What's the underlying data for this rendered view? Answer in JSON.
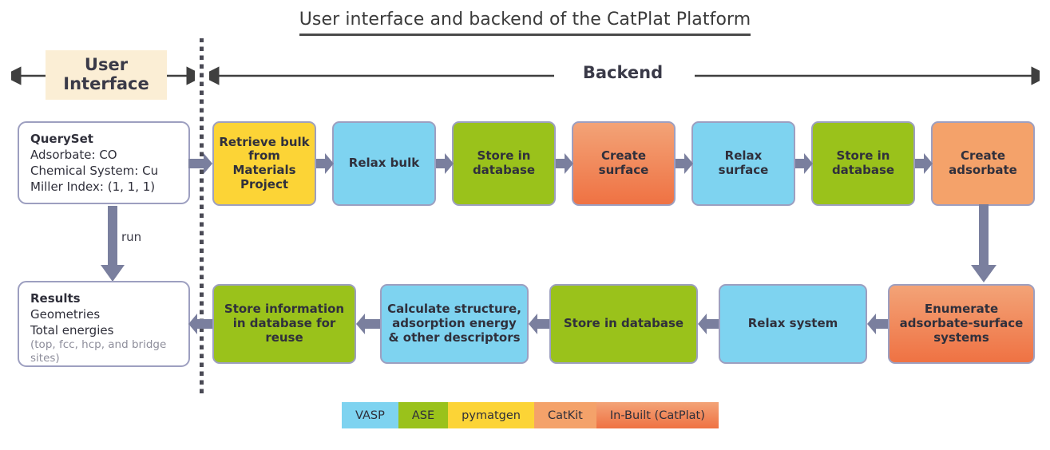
{
  "title": "User interface and backend of the CatPlat Platform",
  "headers": {
    "user_interface": "User\nInterface",
    "user_interface_line1": "User",
    "user_interface_line2": "Interface",
    "backend": "Backend"
  },
  "user_interface": {
    "queryset": {
      "title": "QuerySet",
      "line1": "Adsorbate: CO",
      "line2": "Chemical System: Cu",
      "line3": "Miller Index: (1, 1, 1)"
    },
    "run_label": "run",
    "results": {
      "title": "Results",
      "line1": "Geometries",
      "line2": "Total energies",
      "note": "(top, fcc, hcp, and bridge sites)"
    }
  },
  "backend": {
    "row1": [
      {
        "label": "Retrieve bulk from Materials Project",
        "tool": "pymatgen",
        "color": "#fcd436"
      },
      {
        "label": "Relax bulk",
        "tool": "VASP",
        "color": "#7ed3f0"
      },
      {
        "label": "Store in database",
        "tool": "ASE",
        "color": "#9ac21b"
      },
      {
        "label": "Create surface",
        "tool": "In-Built (CatPlat)",
        "color": "#ef7243"
      },
      {
        "label": "Relax surface",
        "tool": "VASP",
        "color": "#7ed3f0"
      },
      {
        "label": "Store in database",
        "tool": "ASE",
        "color": "#9ac21b"
      },
      {
        "label": "Create adsorbate",
        "tool": "CatKit",
        "color": "#f4a26a"
      }
    ],
    "row2": [
      {
        "label": "Store information in database for reuse",
        "tool": "ASE",
        "color": "#9ac21b"
      },
      {
        "label": "Calculate structure, adsorption energy & other descriptors",
        "tool": "VASP",
        "color": "#7ed3f0"
      },
      {
        "label": "Store in database",
        "tool": "ASE",
        "color": "#9ac21b"
      },
      {
        "label": "Relax system",
        "tool": "VASP",
        "color": "#7ed3f0"
      },
      {
        "label": "Enumerate adsorbate-surface systems",
        "tool": "In-Built (CatPlat)",
        "color": "#ef7243"
      }
    ]
  },
  "legend": [
    {
      "label": "VASP",
      "color": "#7ed3f0"
    },
    {
      "label": "ASE",
      "color": "#9ac21b"
    },
    {
      "label": "pymatgen",
      "color": "#fcd436"
    },
    {
      "label": "CatKit",
      "color": "#f4a26a"
    },
    {
      "label": "In-Built (CatPlat)",
      "color": "#ef7243"
    }
  ],
  "colors": {
    "arrow": "#7a7f9e",
    "border": "#9d9fc0",
    "ui_band": "#fbeed5",
    "text": "#30303c",
    "axis": "#3f3f3f"
  }
}
